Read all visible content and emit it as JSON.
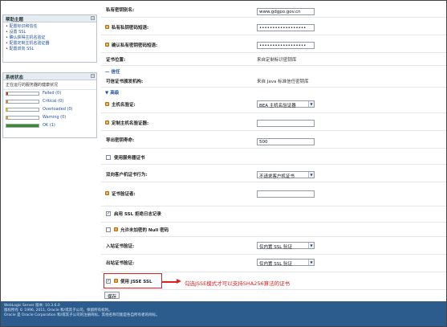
{
  "help": {
    "title": "帮助主题",
    "items": [
      "配置标识和信任",
      "设置 SSL",
      "确认获得主机名验证",
      "配置定制主机名验证器",
      "配置双向 SSL"
    ]
  },
  "system_status": {
    "title": "系统状态",
    "subtitle": "正在运行的服务器的健康状况",
    "rows": [
      {
        "label": "Failed (0)",
        "fill": 0,
        "color": "#c0392b"
      },
      {
        "label": "Critical (0)",
        "fill": 0,
        "color": "#e67e22"
      },
      {
        "label": "Overloaded (0)",
        "fill": 0,
        "color": "#f1c40f"
      },
      {
        "label": "Warning (0)",
        "fill": 0,
        "color": "#f39c12"
      },
      {
        "label": "OK (1)",
        "fill": 1,
        "color": "#3d8a2e"
      }
    ]
  },
  "form": {
    "private_key_alias": {
      "label": "私有密钥别名:",
      "value": "www.gdgpo.gov.cn"
    },
    "private_key_pass": {
      "label": "私有私钥密码短语:",
      "value": "••••••••••••••••••"
    },
    "confirm_pass": {
      "label": "确认私有密钥密码短语:",
      "value": "••••••••••••••••••"
    },
    "cert_location": {
      "label": "证书位置:",
      "value": "来自定制标识密钥库"
    },
    "trust_section": "信任",
    "trusted_ca": {
      "label": "可信证书颁发机构:",
      "value": "来自 Java 标准信任密钥库"
    },
    "advanced_section": "高级",
    "hostname_verify": {
      "label": "主机名验证:",
      "value": "BEA 主机名验证器"
    },
    "custom_hostname": {
      "label": "定制主机名验证器:",
      "value": ""
    },
    "export_key_lifespan": {
      "label": "导出密钥寿命:",
      "value": "500"
    },
    "use_server_certs": {
      "label": "使用服务器证书"
    },
    "client_cert_behavior": {
      "label": "双向客户机证书行为:",
      "value": "不请求客户机证书"
    },
    "cert_authenticator": {
      "label": "证书验证者:",
      "value": ""
    },
    "ssl_rejection_log": {
      "label": "启用 SSL 拒绝日志记录"
    },
    "null_cipher": {
      "label": "允许未加密的 Null 密码"
    },
    "inbound_cert_validation": {
      "label": "入站证书验证:",
      "value": "仅内置 SSL 验证"
    },
    "outbound_cert_validation": {
      "label": "出站证书验证:",
      "value": "仅内置 SSL 验证"
    },
    "use_jsse": {
      "label": "使用 JSSE SSL"
    },
    "save": "保存"
  },
  "annotation": "勾选JSSE模式才可以支持SHA256算法的证书",
  "footer": {
    "line1": "WebLogic Server 版本: 10.3.6.0",
    "line2": "版权所有 © 1996, 2011, Oracle 和/或其子公司。保留所有权利。",
    "line3": "Oracle 是 Oracle Corporation 和/或其子公司的注册商标。其他名称可能是各自所有者的商标。"
  }
}
